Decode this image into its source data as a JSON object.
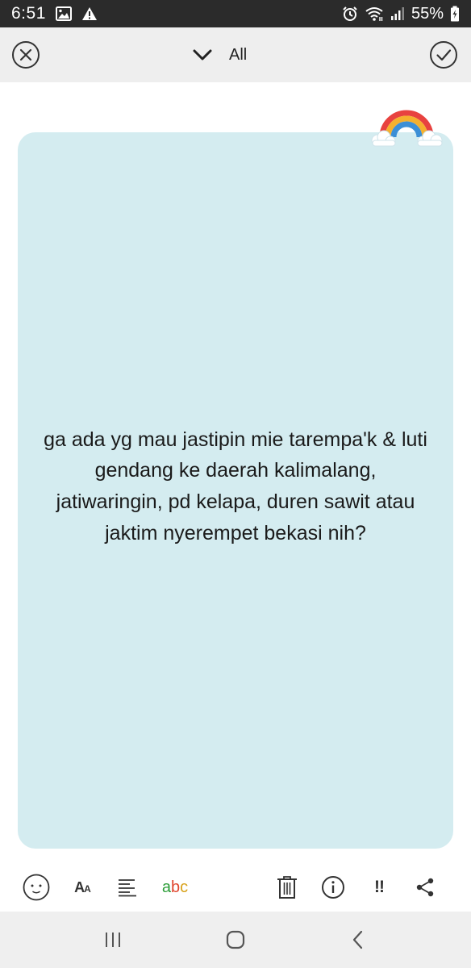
{
  "status_bar": {
    "time": "6:51",
    "battery_percent": "55%",
    "icons": [
      "image-icon",
      "warning-icon",
      "alarm-icon",
      "wifi-icon",
      "signal-icon",
      "battery-charging-icon"
    ]
  },
  "header": {
    "category_label": "All",
    "icons": {
      "close": "close-circle-icon",
      "dropdown": "chevron-down-icon",
      "confirm": "check-circle-icon"
    }
  },
  "note": {
    "body": "ga ada yg mau jastipin mie tarempa'k & luti gendang ke daerah kalimalang, jatiwaringin, pd kelapa, duren sawit atau jaktim nyerempet bekasi nih?",
    "background_color": "#d4ecf0",
    "sticker": "rainbow-sticker-icon"
  },
  "toolbar": {
    "font_size_big": "A",
    "font_size_small": "A",
    "spell_a": "a",
    "spell_b": "b",
    "spell_c": "c",
    "spell_colors": [
      "#2e9e3a",
      "#e0452e",
      "#d8a21a"
    ],
    "priority_label": "!!",
    "icons": [
      "emoji-icon",
      "font-size-icon",
      "align-icon",
      "spell-check-icon",
      "trash-icon",
      "info-icon",
      "priority-icon",
      "share-icon"
    ]
  },
  "navigation": {
    "icons": [
      "recents-icon",
      "home-icon",
      "back-icon"
    ]
  },
  "colors": {
    "status_bar_bg": "#2b2b2b",
    "header_bg": "#eeeeee",
    "nav_bg": "#efefef",
    "icon_gray": "#333333"
  }
}
